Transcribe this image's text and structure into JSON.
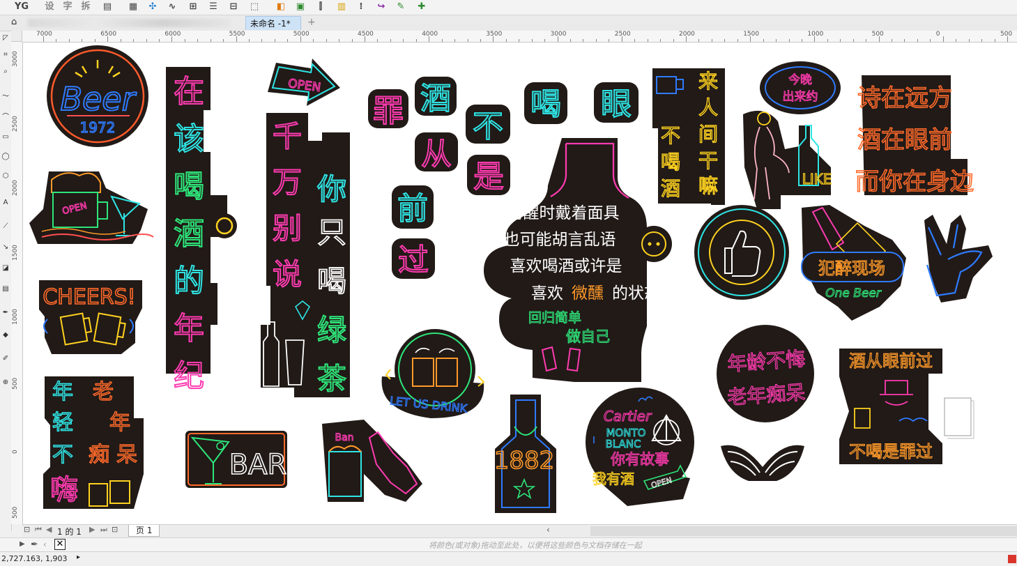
{
  "app": {
    "toolbar_text": [
      "YG",
      "设",
      "字",
      "拆"
    ],
    "document_tab": "未命名 -1*",
    "add_tab": "+"
  },
  "ruler": {
    "horizontal_labels": [
      "7000",
      "6500",
      "6000",
      "5500",
      "5000",
      "4500",
      "4000",
      "3500",
      "3000",
      "2500",
      "2000",
      "1500",
      "1000",
      "500",
      "0",
      "500"
    ],
    "vertical_labels": [
      "3000",
      "2500",
      "2000",
      "1500",
      "1000",
      "500",
      "0",
      "500"
    ]
  },
  "pages": {
    "page_counter": "1 的 1",
    "page_tab": "页 1"
  },
  "palette": {
    "hint": "将颜色(或对象)拖动至此处，以便将这些颜色与文档存储在一起"
  },
  "status": {
    "coordinates": "2,727.163, 1,903"
  },
  "stickers": {
    "beer": {
      "top": "Beer",
      "year": "1972"
    },
    "zai_gai": [
      "在",
      "该",
      "喝",
      "酒",
      "的",
      "年",
      "纪"
    ],
    "open_arrow": "OPEN",
    "qian_wan": [
      "千",
      "万",
      "别",
      "说"
    ],
    "ni_zhi_he": [
      "你",
      "只",
      "喝",
      "绿",
      "茶"
    ],
    "zui": "罪",
    "jiu": "酒",
    "cong": "从",
    "qian": "前",
    "bu": "不",
    "shi": "是",
    "guo": "过",
    "he": "喝",
    "yan": "眼",
    "lai_ren": [
      "来",
      "人",
      "间",
      "干",
      "嘛"
    ],
    "bu_he_jiu": [
      "不",
      "喝",
      "酒"
    ],
    "jinwan": [
      "今晚",
      "出来约"
    ],
    "like": "LIKE",
    "shi_poem": [
      "诗在远方",
      "酒在眼前",
      "而你在身边"
    ],
    "bottle_lines": [
      "清醒时戴着面具",
      "醉了也可能胡言乱语",
      "喜欢喝酒或许是",
      "喜欢",
      "微醺",
      "的状态",
      "回归简单",
      "做自己"
    ],
    "open_beer": "OPEN",
    "cheers": "CHEERS!",
    "let_us_drink": "LET US DRINK",
    "fan_zui": "犯醉现场",
    "one_beer": "One Beer",
    "nian_qing": [
      "年",
      "老",
      "轻",
      "年",
      "不",
      "痴",
      "呆",
      "嗨"
    ],
    "bar": "BAR",
    "ban": "Ban",
    "number_1882": "1882",
    "cartier": [
      "Cartier",
      "MONTO",
      "BLANC",
      "你有故事",
      "我有酒",
      "OPEN"
    ],
    "nian_ling": [
      "年龄不悔",
      "老年痴呆"
    ],
    "jiu_cong": [
      "酒从眼前过",
      "不喝是罪过"
    ]
  }
}
